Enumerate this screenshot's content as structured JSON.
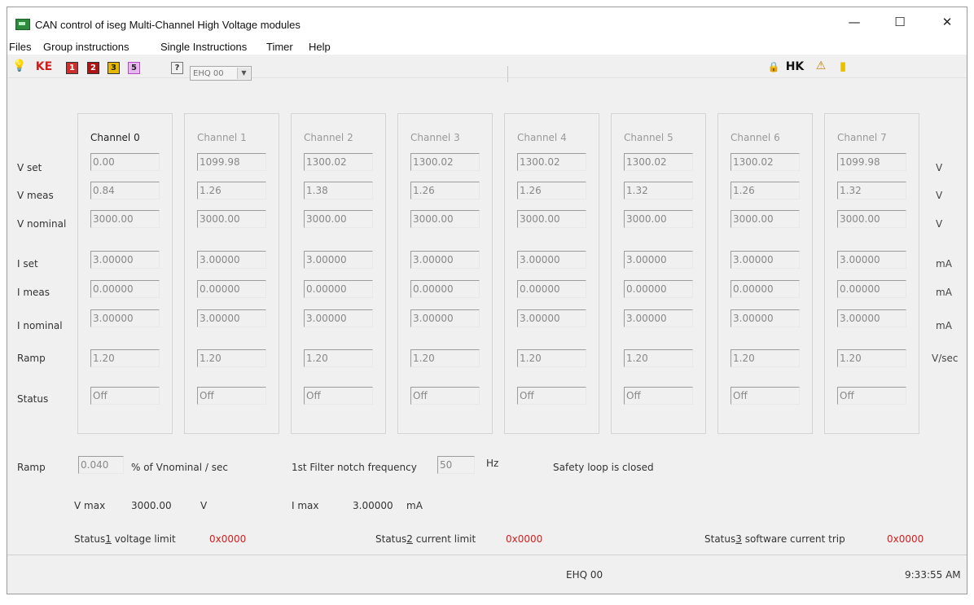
{
  "window": {
    "title": "CAN control of iseg Multi-Channel High Voltage modules",
    "controls": {
      "minimize": "—",
      "maximize": "☐",
      "close": "✕"
    }
  },
  "menu": [
    "Files",
    "Group instructions",
    "Single Instructions",
    "Timer",
    "Help"
  ],
  "toolbar": {
    "left_icons": [
      {
        "name": "lightbulb-icon",
        "glyph": "💡",
        "color": "#c9a400"
      },
      {
        "name": "ke-icon",
        "glyph": "KE",
        "color": "#d21d1d"
      },
      {
        "name": "one-icon",
        "glyph": "1",
        "color": "#cc2e2e"
      },
      {
        "name": "two-icon",
        "glyph": "2",
        "color": "#b01414"
      },
      {
        "name": "three-icon",
        "glyph": "3",
        "color": "#e8b800"
      },
      {
        "name": "five-icon",
        "glyph": "5",
        "color": "#b548c6"
      },
      {
        "name": "help-icon",
        "glyph": "?",
        "color": "#555555"
      }
    ],
    "module_select": "EHQ 00",
    "right_icons": [
      {
        "name": "lock-icon",
        "glyph": "🔒",
        "color": "#333333"
      },
      {
        "name": "hk-icon",
        "glyph": "HK",
        "color": "#111111"
      },
      {
        "name": "warning-icon",
        "glyph": "⚠",
        "color": "#c87a00"
      },
      {
        "name": "exit-icon",
        "glyph": "▮",
        "color": "#e8c000"
      }
    ]
  },
  "row_labels": {
    "vset": "V set",
    "vmeas": "V meas",
    "vnominal": "V nominal",
    "iset": "I set",
    "imeas": "I meas",
    "inominal": "I nominal",
    "ramp": "Ramp",
    "status": "Status"
  },
  "units": {
    "v1": "V",
    "v2": "V",
    "v3": "V",
    "i1": "mA",
    "i2": "mA",
    "i3": "mA",
    "ramp": "V/sec"
  },
  "channels": [
    {
      "name": "Channel 0",
      "vset": "0.00",
      "vmeas": "0.84",
      "vnominal": "3000.00",
      "iset": "3.00000",
      "imeas": "0.00000",
      "inominal": "3.00000",
      "ramp": "1.20",
      "status": "Off"
    },
    {
      "name": "Channel 1",
      "vset": "1099.98",
      "vmeas": "1.26",
      "vnominal": "3000.00",
      "iset": "3.00000",
      "imeas": "0.00000",
      "inominal": "3.00000",
      "ramp": "1.20",
      "status": "Off"
    },
    {
      "name": "Channel 2",
      "vset": "1300.02",
      "vmeas": "1.38",
      "vnominal": "3000.00",
      "iset": "3.00000",
      "imeas": "0.00000",
      "inominal": "3.00000",
      "ramp": "1.20",
      "status": "Off"
    },
    {
      "name": "Channel 3",
      "vset": "1300.02",
      "vmeas": "1.26",
      "vnominal": "3000.00",
      "iset": "3.00000",
      "imeas": "0.00000",
      "inominal": "3.00000",
      "ramp": "1.20",
      "status": "Off"
    },
    {
      "name": "Channel 4",
      "vset": "1300.02",
      "vmeas": "1.26",
      "vnominal": "3000.00",
      "iset": "3.00000",
      "imeas": "0.00000",
      "inominal": "3.00000",
      "ramp": "1.20",
      "status": "Off"
    },
    {
      "name": "Channel 5",
      "vset": "1300.02",
      "vmeas": "1.32",
      "vnominal": "3000.00",
      "iset": "3.00000",
      "imeas": "0.00000",
      "inominal": "3.00000",
      "ramp": "1.20",
      "status": "Off"
    },
    {
      "name": "Channel 6",
      "vset": "1300.02",
      "vmeas": "1.26",
      "vnominal": "3000.00",
      "iset": "3.00000",
      "imeas": "0.00000",
      "inominal": "3.00000",
      "ramp": "1.20",
      "status": "Off"
    },
    {
      "name": "Channel 7",
      "vset": "1099.98",
      "vmeas": "1.32",
      "vnominal": "3000.00",
      "iset": "3.00000",
      "imeas": "0.00000",
      "inominal": "3.00000",
      "ramp": "1.20",
      "status": "Off"
    }
  ],
  "bottom": {
    "ramp_label": "Ramp",
    "ramp_value": "0.040",
    "ramp_unit": "% of Vnominal / sec",
    "filter_label": "1st Filter notch frequency",
    "filter_value": "50",
    "filter_unit": "Hz",
    "safety_text": "Safety loop is closed",
    "vmax_label": "V max",
    "vmax_value": "3000.00",
    "vmax_unit": "V",
    "imax_label": "I max",
    "imax_value": "3.00000",
    "imax_unit": "mA",
    "status1_prefix": "Status",
    "status1_digit": "1",
    "status1_suffix": " voltage limit",
    "status1_value": "0x0000",
    "status2_prefix": "Status",
    "status2_digit": "2",
    "status2_suffix": " current limit",
    "status2_value": "0x0000",
    "status3_prefix": "Status",
    "status3_digit": "3",
    "status3_suffix": " software current trip",
    "status3_value": "0x0000",
    "status_value_color": "#d22020"
  },
  "statusbar": {
    "module": "EHQ 00",
    "time": "9:33:55 AM"
  }
}
